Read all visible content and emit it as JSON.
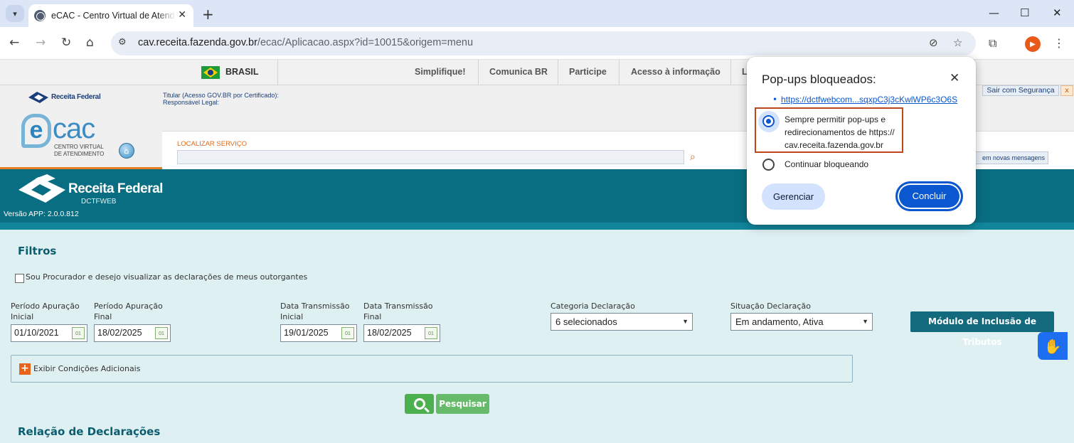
{
  "browser": {
    "tab_title": "eCAC - Centro Virtual de Atendimento",
    "url_host": "cav.receita.fazenda.gov.br",
    "url_path": "/ecac/Aplicacao.aspx?id=10015&origem=menu",
    "profile_letter": "▶"
  },
  "govbar": {
    "country": "BRASIL",
    "links": [
      "Simplifique!",
      "Comunica BR",
      "Participe",
      "Acesso à informação",
      "L"
    ]
  },
  "ecac": {
    "brand_small": "Receita Federal",
    "titular_line1": "Titular (Acesso GOV.BR por Certificado):",
    "titular_line2": "Responsável Legal:",
    "logo_e": "e",
    "logo_word": "cac",
    "logo_sub1": "CENTRO VIRTUAL",
    "logo_sub2": "DE ATENDIMENTO",
    "search_label": "LOCALIZAR SERVIÇO",
    "exit_label": "Sair com Segurança",
    "exit_x": "x",
    "messages_label": "em novas mensagens"
  },
  "app": {
    "brand": "Receita Federal",
    "system": "DCTFWEB",
    "version": "Versão APP: 2.0.0.812"
  },
  "filters": {
    "title": "Filtros",
    "procurador_label": "Sou Procurador e desejo visualizar as declarações de meus outorgantes",
    "periodo_inicial_label_1": "Período Apuração",
    "periodo_inicial_label_2": "Inicial",
    "periodo_inicial_value": "01/10/2021",
    "periodo_final_label_1": "Período Apuração",
    "periodo_final_label_2": "Final",
    "periodo_final_value": "18/02/2025",
    "trans_inicial_label_1": "Data Transmissão",
    "trans_inicial_label_2": "Inicial",
    "trans_inicial_value": "19/01/2025",
    "trans_final_label_1": "Data Transmissão",
    "trans_final_label_2": "Final",
    "trans_final_value": "18/02/2025",
    "calendar_glyph": "01",
    "categoria_label": "Categoria Declaração",
    "categoria_value": "6 selecionados",
    "situacao_label": "Situação Declaração",
    "situacao_value": "Em andamento, Ativa",
    "modulo_button": "Módulo de Inclusão de Tributos",
    "condicoes_label": "Exibir Condições Adicionais",
    "pesquisar_button": "Pesquisar"
  },
  "relacao_title": "Relação de Declarações",
  "popup": {
    "title": "Pop-ups bloqueados:",
    "link": "https://dctfwebcom...sqxpC3j3cKwlWP6c3O6S",
    "option_allow_1": "Sempre permitir pop-ups e",
    "option_allow_2": "redirecionamentos de https://",
    "option_allow_3": "cav.receita.fazenda.gov.br",
    "option_block": "Continuar bloqueando",
    "manage_button": "Gerenciar",
    "done_button": "Concluir",
    "selected_option": "allow"
  },
  "colors": {
    "banner": "#0a6e82",
    "accent_orange": "#e67e22",
    "page_bg": "#dff0f2",
    "chrome_blue": "#0b57d0"
  }
}
